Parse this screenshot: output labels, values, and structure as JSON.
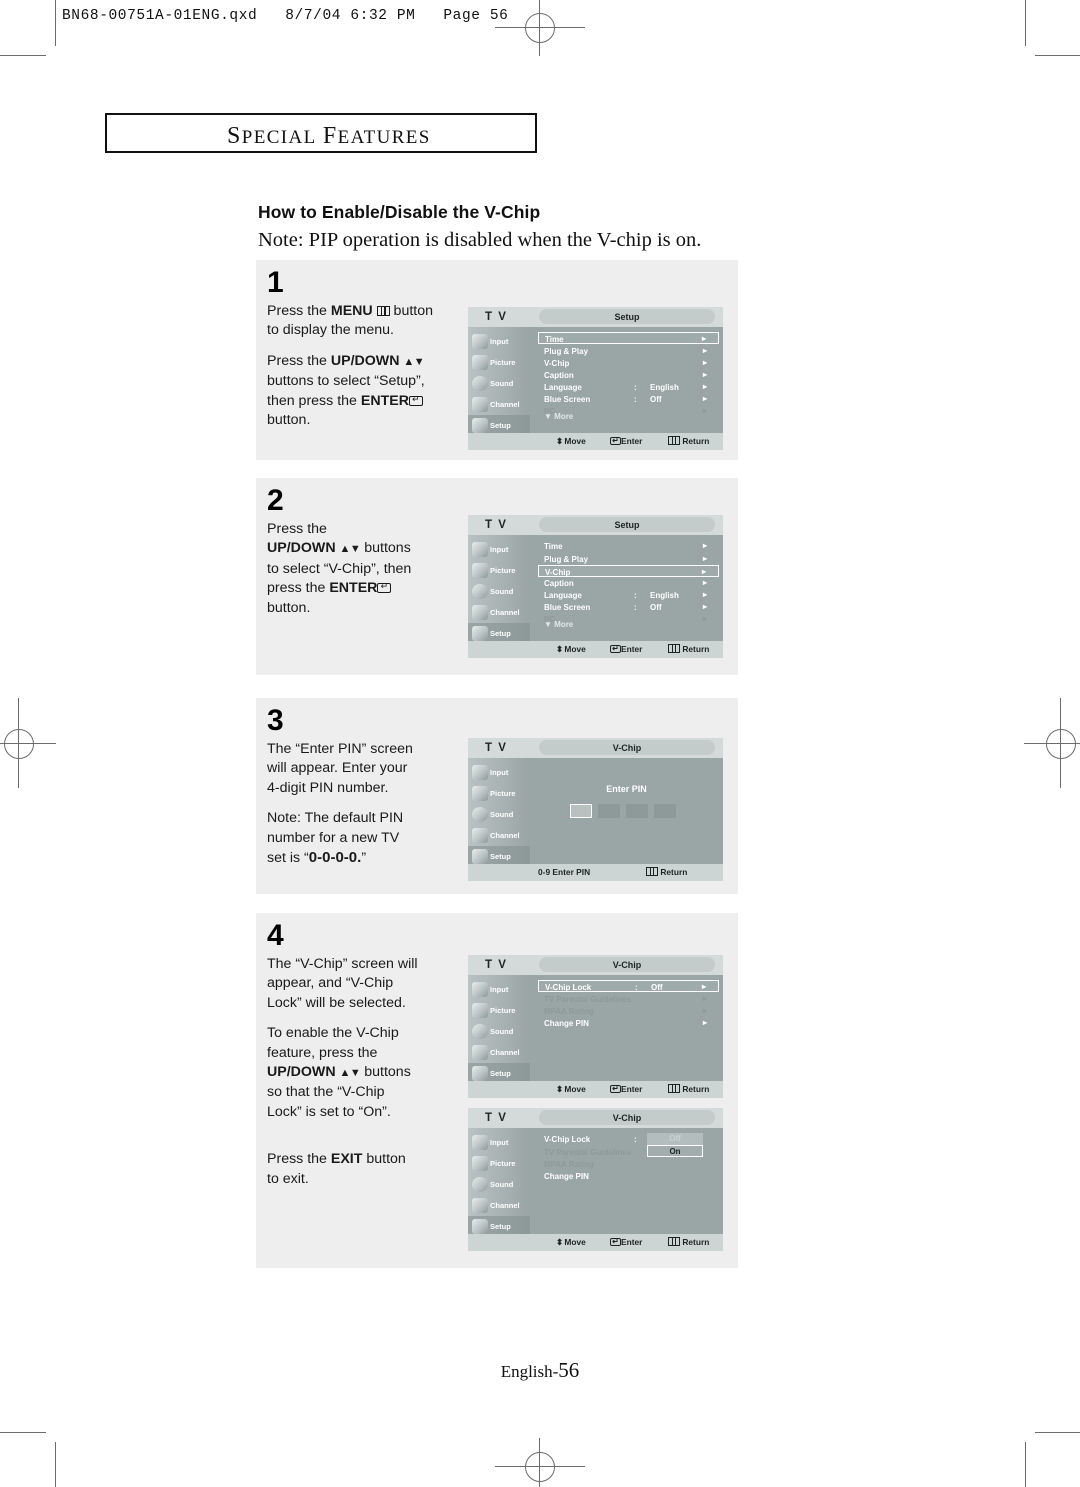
{
  "print_header": "BN68-00751A-01ENG.qxd   8/7/04 6:32 PM   Page 56",
  "section": {
    "title_small_caps": "SPECIAL FEATURES",
    "s": "S",
    "pecial": "PECIAL",
    "f": "F",
    "eatures": "EATURES"
  },
  "heading": "How to Enable/Disable the V-Chip",
  "note": "Note: PIP operation is disabled when the V-chip is on.",
  "page_footer": {
    "label": "English-",
    "number": "56"
  },
  "osd_footer": {
    "move": "Move",
    "enter": "Enter",
    "return": "Return",
    "pin_hint": "0-9 Enter PIN"
  },
  "sidebar": [
    {
      "label": "Input",
      "icon": "camera-icon"
    },
    {
      "label": "Picture",
      "icon": "picture-icon"
    },
    {
      "label": "Sound",
      "icon": "speaker-icon"
    },
    {
      "label": "Channel",
      "icon": "antenna-icon"
    },
    {
      "label": "Setup",
      "icon": "setup-icon"
    }
  ],
  "tv_logo": "T V",
  "steps": [
    {
      "number": "1",
      "paragraphs": [
        {
          "parts": [
            {
              "t": "Press the ",
              "b": false
            },
            {
              "t": "MENU",
              "b": true
            },
            {
              "t": " ",
              "b": false
            },
            {
              "t": "[menu-icon]",
              "icon": "menu"
            },
            {
              "t": " button",
              "b": false
            },
            {
              "t": "\nto display the menu.",
              "b": false
            }
          ]
        },
        {
          "parts": [
            {
              "t": "Press the ",
              "b": false
            },
            {
              "t": "UP/DOWN",
              "b": true
            },
            {
              "t": " ",
              "b": false
            },
            {
              "t": "▲▼",
              "b": true,
              "arrows": true
            },
            {
              "t": "\nbuttons to select “Setup”,\nthen press the ",
              "b": false
            },
            {
              "t": "ENTER",
              "b": true
            },
            {
              "t": "[enter-icon]",
              "icon": "enter"
            },
            {
              "t": "\nbutton.",
              "b": false
            }
          ]
        }
      ],
      "screen": {
        "title": "Setup",
        "active_sidebar": "Setup",
        "rows": [
          {
            "label": "Time",
            "colon": "",
            "value": "",
            "arrow": "▸",
            "selected": true,
            "dim": false
          },
          {
            "label": "Plug & Play",
            "colon": "",
            "value": "",
            "arrow": "▸",
            "selected": false,
            "dim": false
          },
          {
            "label": "V-Chip",
            "colon": "",
            "value": "",
            "arrow": "▸",
            "selected": false,
            "dim": false
          },
          {
            "label": "Caption",
            "colon": "",
            "value": "",
            "arrow": "▸",
            "selected": false,
            "dim": false
          },
          {
            "label": "Language",
            "colon": ":",
            "value": "English",
            "arrow": "▸",
            "selected": false,
            "dim": false
          },
          {
            "label": "Blue Screen",
            "colon": ":",
            "value": "Off",
            "arrow": "▸",
            "selected": false,
            "dim": false
          },
          {
            "label": "PC",
            "colon": "",
            "value": "",
            "arrow": "▸",
            "selected": false,
            "dim": true
          }
        ],
        "more": "▼ More",
        "footer_type": "move-enter-return"
      }
    },
    {
      "number": "2",
      "paragraphs": [
        {
          "parts": [
            {
              "t": "Press the",
              "b": false
            },
            {
              "t": "\n",
              "b": false
            },
            {
              "t": "UP/DOWN",
              "b": true
            },
            {
              "t": " ",
              "b": false
            },
            {
              "t": "▲▼",
              "b": true,
              "arrows": true
            },
            {
              "t": " buttons",
              "b": false
            },
            {
              "t": "\nto select “V-Chip”, then\npress the ",
              "b": false
            },
            {
              "t": "ENTER",
              "b": true
            },
            {
              "t": "[enter-icon]",
              "icon": "enter"
            },
            {
              "t": "\nbutton.",
              "b": false
            }
          ]
        }
      ],
      "screen": {
        "title": "Setup",
        "active_sidebar": "Setup",
        "rows": [
          {
            "label": "Time",
            "colon": "",
            "value": "",
            "arrow": "▸",
            "selected": false,
            "dim": false
          },
          {
            "label": "Plug & Play",
            "colon": "",
            "value": "",
            "arrow": "▸",
            "selected": false,
            "dim": false
          },
          {
            "label": "V-Chip",
            "colon": "",
            "value": "",
            "arrow": "▸",
            "selected": true,
            "dim": false
          },
          {
            "label": "Caption",
            "colon": "",
            "value": "",
            "arrow": "▸",
            "selected": false,
            "dim": false
          },
          {
            "label": "Language",
            "colon": ":",
            "value": "English",
            "arrow": "▸",
            "selected": false,
            "dim": false
          },
          {
            "label": "Blue Screen",
            "colon": ":",
            "value": "Off",
            "arrow": "▸",
            "selected": false,
            "dim": false
          },
          {
            "label": "PC",
            "colon": "",
            "value": "",
            "arrow": "▸",
            "selected": false,
            "dim": true
          }
        ],
        "more": "▼ More",
        "footer_type": "move-enter-return"
      }
    },
    {
      "number": "3",
      "paragraphs": [
        {
          "parts": [
            {
              "t": "The “Enter PIN” screen\nwill appear. Enter your\n4-digit PIN number.",
              "b": false
            }
          ]
        },
        {
          "parts": [
            {
              "t": "Note: The default PIN\nnumber for a new TV\nset is “",
              "b": false
            },
            {
              "t": "0-0-0-0.",
              "b": true
            },
            {
              "t": "”",
              "b": false
            }
          ]
        }
      ],
      "screen": {
        "title": "V-Chip",
        "active_sidebar": "Setup",
        "pin_label": "Enter PIN",
        "pin_boxes": 4,
        "pin_active_index": 0,
        "footer_type": "pin"
      }
    },
    {
      "number": "4",
      "paragraphs": [
        {
          "parts": [
            {
              "t": "The “V-Chip” screen will\nappear, and “V-Chip\nLock” will be selected.",
              "b": false
            }
          ]
        },
        {
          "parts": [
            {
              "t": "To enable the V-Chip\nfeature, press the\n",
              "b": false
            },
            {
              "t": "UP/DOWN",
              "b": true
            },
            {
              "t": " ",
              "b": false
            },
            {
              "t": "▲▼",
              "b": true,
              "arrows": true
            },
            {
              "t": " buttons",
              "b": false
            },
            {
              "t": "\nso that the “V-Chip\nLock” is set to “On”.",
              "b": false
            }
          ]
        },
        {
          "parts": [
            {
              "t": "Press the ",
              "b": false
            },
            {
              "t": "EXIT",
              "b": true
            },
            {
              "t": " button\nto exit.",
              "b": false
            }
          ]
        }
      ],
      "screen": {
        "title": "V-Chip",
        "active_sidebar": "Setup",
        "rows": [
          {
            "label": "V-Chip Lock",
            "colon": ":",
            "value": "Off",
            "arrow": "▸",
            "selected": true,
            "dim": false
          },
          {
            "label": "TV Parental Guidelines",
            "colon": "",
            "value": "",
            "arrow": "▸",
            "selected": false,
            "dim": true
          },
          {
            "label": "MPAA Rating",
            "colon": "",
            "value": "",
            "arrow": "▸",
            "selected": false,
            "dim": true
          },
          {
            "label": "Change PIN",
            "colon": "",
            "value": "",
            "arrow": "▸",
            "selected": false,
            "dim": false
          }
        ],
        "footer_type": "move-enter-return"
      },
      "screen2": {
        "title": "V-Chip",
        "active_sidebar": "Setup",
        "rows": [
          {
            "label": "V-Chip Lock",
            "colon": ":",
            "value": "",
            "arrow": "",
            "selected": false,
            "dim": false
          },
          {
            "label": "TV Parental Guidelines",
            "colon": "",
            "value": "",
            "arrow": "",
            "selected": false,
            "dim": true
          },
          {
            "label": "MPAA Rating",
            "colon": "",
            "value": "",
            "arrow": "",
            "selected": false,
            "dim": true
          },
          {
            "label": "Change PIN",
            "colon": "",
            "value": "",
            "arrow": "",
            "selected": false,
            "dim": false
          }
        ],
        "dropdown": {
          "options": [
            "Off",
            "On"
          ],
          "selected": "On"
        },
        "footer_type": "move-enter-return"
      }
    }
  ]
}
